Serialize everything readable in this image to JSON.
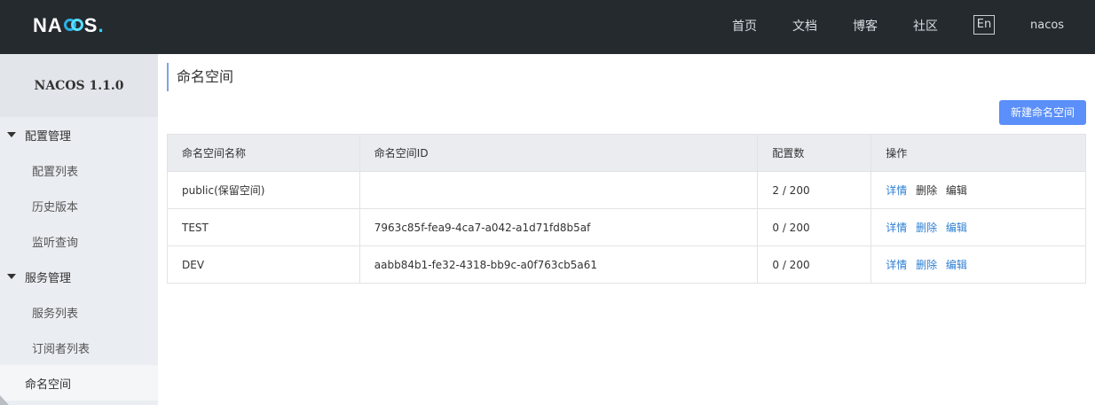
{
  "header": {
    "logo_text_pre": "NA",
    "logo_text_post": "S",
    "logo_dot": ".",
    "nav": [
      "首页",
      "文档",
      "博客",
      "社区"
    ],
    "lang": "En",
    "user": "nacos"
  },
  "sidebar": {
    "title": "NACOS 1.1.0",
    "groups": [
      {
        "label": "配置管理",
        "items": [
          "配置列表",
          "历史版本",
          "监听查询"
        ]
      },
      {
        "label": "服务管理",
        "items": [
          "服务列表",
          "订阅者列表"
        ]
      }
    ],
    "namespace": "命名空间"
  },
  "main": {
    "title": "命名空间",
    "new_button": "新建命名空间",
    "columns": [
      "命名空间名称",
      "命名空间ID",
      "配置数",
      "操作"
    ],
    "rows": [
      {
        "name": "public(保留空间)",
        "id": "",
        "count": "2 / 200",
        "ops": [
          "详情",
          "删除",
          "编辑"
        ]
      },
      {
        "name": "TEST",
        "id": "7963c85f-fea9-4ca7-a042-a1d71fd8b5af",
        "count": "0 / 200",
        "ops": [
          "详情",
          "删除",
          "编辑"
        ]
      },
      {
        "name": "DEV",
        "id": "aabb84b1-fe32-4318-bb9c-a0f763cb5a61",
        "count": "0 / 200",
        "ops": [
          "详情",
          "删除",
          "编辑"
        ]
      }
    ]
  },
  "colors": {
    "header_bg": "#252a2f",
    "accent": "#5b8ff9",
    "link": "#2e7fd3",
    "sidebar_bg": "#eaedf1"
  }
}
